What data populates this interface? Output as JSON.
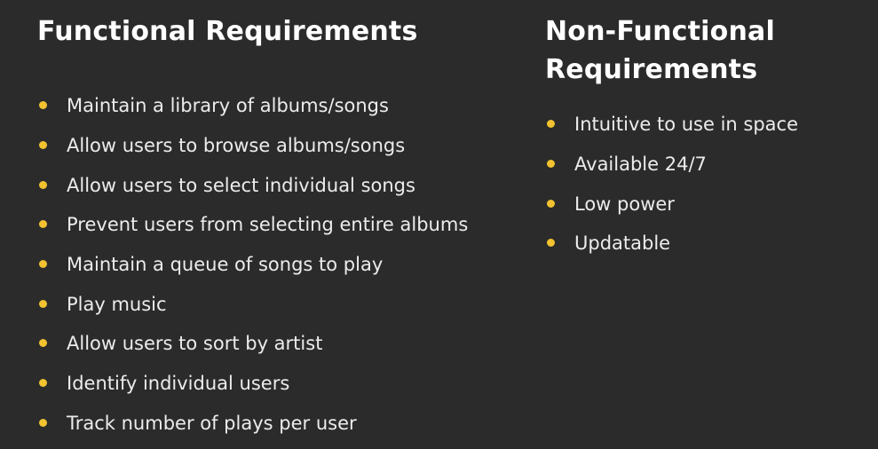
{
  "functional": {
    "title": "Functional Requirements",
    "items": [
      "Maintain a library of albums/songs",
      "Allow users to browse albums/songs",
      "Allow users to select individual songs",
      "Prevent users from selecting entire albums",
      "Maintain a queue of songs to play",
      "Play music",
      "Allow users to sort by artist",
      "Identify individual users",
      "Track number of plays per user"
    ]
  },
  "non_functional": {
    "title_line1": "Non-Functional",
    "title_line2": "Requirements",
    "items": [
      "Intuitive to use in space",
      "Available 24/7",
      "Low power",
      "Updatable"
    ]
  },
  "colors": {
    "background": "#2b2b2b",
    "heading": "#ffffff",
    "text": "#ececec",
    "bullet": "#f2c230"
  }
}
